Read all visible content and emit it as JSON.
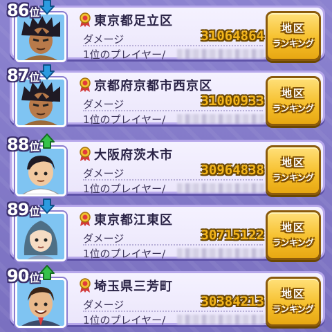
{
  "colors": {
    "up_arrow": "#36c24a",
    "down_arrow": "#2b9be0",
    "damage_value": "#f3b51b",
    "button": "#f6c02d"
  },
  "rows": [
    {
      "rank": "86",
      "rank_suffix": "位",
      "trend": "down",
      "trend_icon": "down-arrow-icon",
      "avatar": "spiky-hair-boy-avatar",
      "region": "東京都足立区",
      "damage_label": "ダメージ",
      "damage_value": "31064864",
      "player_label": "1位のプレイヤー/",
      "button_line1": "地区",
      "button_line2": "ランキング"
    },
    {
      "rank": "87",
      "rank_suffix": "位",
      "trend": "down",
      "trend_icon": "down-arrow-icon",
      "avatar": "spiky-hair-boy-avatar",
      "region": "京都府京都市西京区",
      "damage_label": "ダメージ",
      "damage_value": "31000933",
      "player_label": "1位のプレイヤー/",
      "button_line1": "地区",
      "button_line2": "ランキング"
    },
    {
      "rank": "88",
      "rank_suffix": "位",
      "trend": "up",
      "trend_icon": "up-arrow-icon",
      "avatar": "short-hair-boy-avatar",
      "region": "大阪府茨木市",
      "damage_label": "ダメージ",
      "damage_value": "30964838",
      "player_label": "1位のプレイヤー/",
      "button_line1": "地区",
      "button_line2": "ランキング"
    },
    {
      "rank": "89",
      "rank_suffix": "位",
      "trend": "down",
      "trend_icon": "down-arrow-icon",
      "avatar": "braided-hair-girl-avatar",
      "region": "東京都江東区",
      "damage_label": "ダメージ",
      "damage_value": "30715122",
      "player_label": "1位のプレイヤー/",
      "button_line1": "地区",
      "button_line2": "ランキング"
    },
    {
      "rank": "90",
      "rank_suffix": "位",
      "trend": "up",
      "trend_icon": "up-arrow-icon",
      "avatar": "suit-man-avatar",
      "region": "埼玉県三芳町",
      "damage_label": "ダメージ",
      "damage_value": "30384213",
      "player_label": "1位のプレイヤー/",
      "button_line1": "地区",
      "button_line2": "ランキング"
    }
  ]
}
